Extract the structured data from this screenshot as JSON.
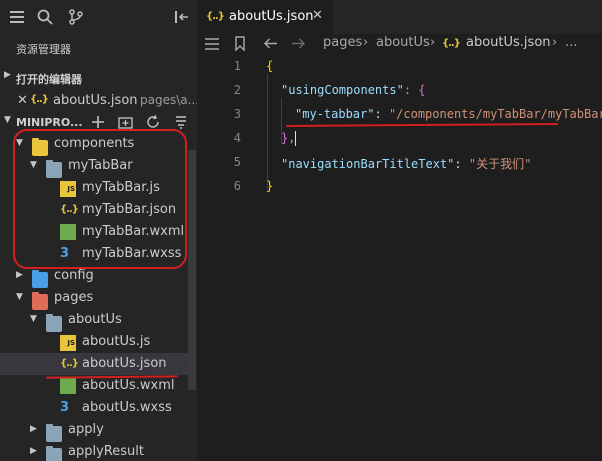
{
  "sidebar": {
    "title": "资源管理器",
    "open_editors_header": "打开的编辑器",
    "open_editor": {
      "close": "✕",
      "name": "aboutUs.json",
      "path": "pages\\a..."
    },
    "project_header": "MINIPRO...",
    "tree": [
      {
        "label": "components",
        "type": "folder-special",
        "color": "#e8c53a",
        "depth": 0,
        "expanded": true
      },
      {
        "label": "myTabBar",
        "type": "folder",
        "depth": 1,
        "expanded": true
      },
      {
        "label": "myTabBar.js",
        "type": "js",
        "depth": 2
      },
      {
        "label": "myTabBar.json",
        "type": "json",
        "depth": 2
      },
      {
        "label": "myTabBar.wxml",
        "type": "wxml",
        "depth": 2
      },
      {
        "label": "myTabBar.wxss",
        "type": "wxss",
        "depth": 2
      },
      {
        "label": "config",
        "type": "folder-special",
        "color": "#4aa0e8",
        "depth": 0,
        "expanded": false
      },
      {
        "label": "pages",
        "type": "folder-special",
        "color": "#e06c5a",
        "depth": 0,
        "expanded": true
      },
      {
        "label": "aboutUs",
        "type": "folder",
        "depth": 1,
        "expanded": true
      },
      {
        "label": "aboutUs.js",
        "type": "js",
        "depth": 2
      },
      {
        "label": "aboutUs.json",
        "type": "json",
        "depth": 2,
        "selected": true
      },
      {
        "label": "aboutUs.wxml",
        "type": "wxml",
        "depth": 2
      },
      {
        "label": "aboutUs.wxss",
        "type": "wxss",
        "depth": 2
      },
      {
        "label": "apply",
        "type": "folder",
        "depth": 1,
        "expanded": false
      },
      {
        "label": "applyResult",
        "type": "folder",
        "depth": 1,
        "expanded": false
      }
    ]
  },
  "editor": {
    "tab_label": "aboutUs.json",
    "tab_close": "✕",
    "breadcrumb": [
      "pages",
      "aboutUs",
      "aboutUs.json",
      "..."
    ],
    "line_numbers": [
      "1",
      "2",
      "3",
      "4",
      "5",
      "6"
    ],
    "code": {
      "l1": "{",
      "l2_key": "\"usingComponents\"",
      "l2_rest": ": {",
      "l3_key": "\"my-tabbar\"",
      "l3_sep": ": ",
      "l3_val": "\"/components/myTabBar/myTabBar\"",
      "l4": "},",
      "l5_key": "\"navigationBarTitleText\"",
      "l5_sep": ": ",
      "l5_val": "\"关于我们\"",
      "l6": "}"
    }
  },
  "icons": {
    "json_glyph": "{..}",
    "js_glyph": "JS",
    "wxss_glyph": "3",
    "expanded": "▼",
    "collapsed": "▶"
  },
  "colors": {
    "annotation_red": "#d21f1f",
    "selection": "#37373d",
    "editor_bg": "#1e1e1e",
    "sidebar_bg": "#252526"
  }
}
